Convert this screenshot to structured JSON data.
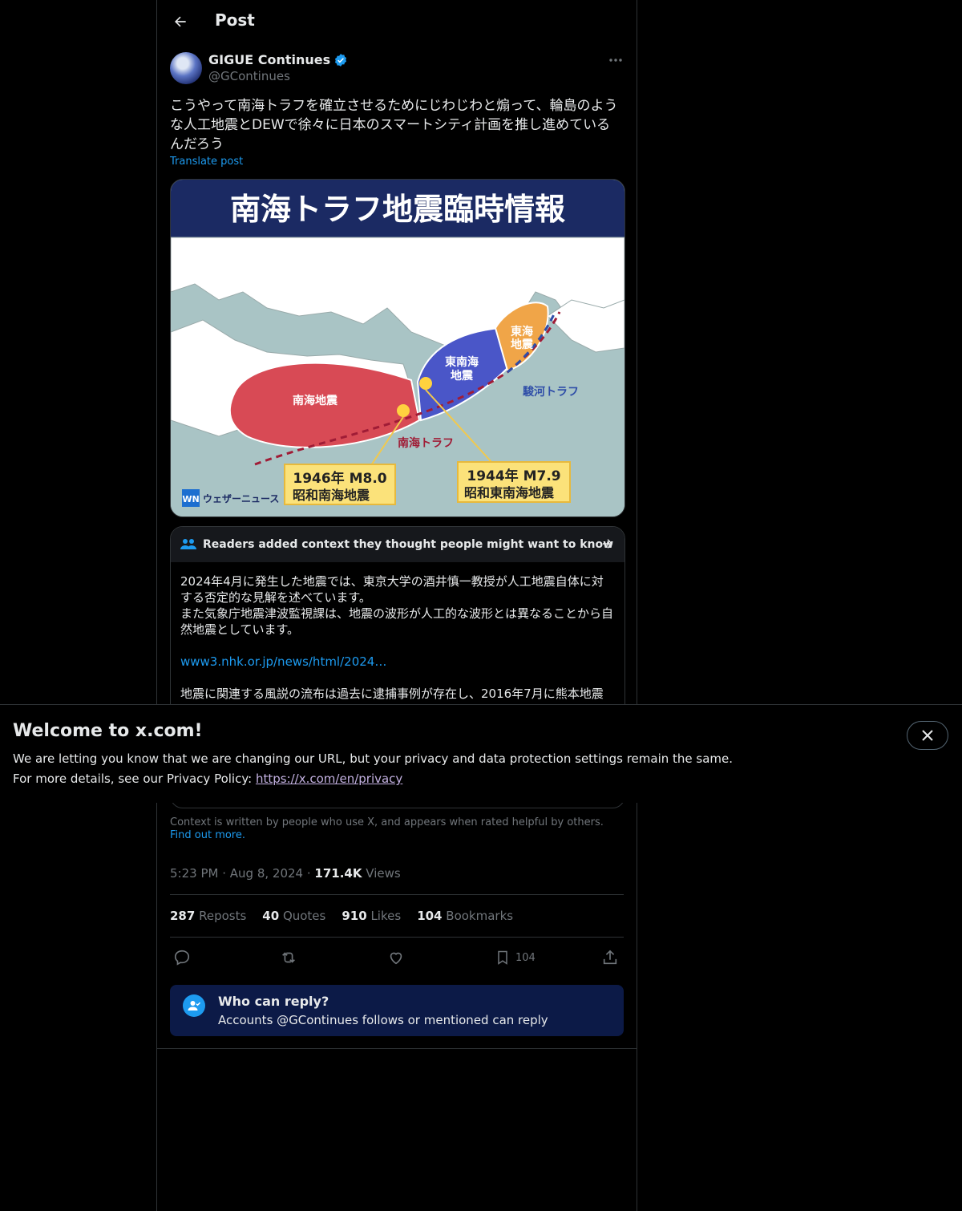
{
  "header": {
    "title": "Post"
  },
  "author": {
    "name": "GIGUE Continues",
    "handle": "@GContinues"
  },
  "post": {
    "text": "こうやって南海トラフを確立させるためにじわじわと煽って、輪島のような人工地震とDEWで徐々に日本のスマートシティ計画を推し進めているんだろう",
    "translate_label": "Translate post",
    "time": "5:23 PM",
    "date": "Aug 8, 2024",
    "views_count": "171.4K",
    "views_label": "Views"
  },
  "image": {
    "title": "南海トラフ地震臨時情報",
    "label_nankai": "南海地震",
    "label_tonankai_1": "東南海",
    "label_tonankai_2": "地震",
    "label_tokai_1": "東海",
    "label_tokai_2": "地震",
    "label_suruga": "駿河トラフ",
    "label_trough": "南海トラフ",
    "box1_line1": "1946年 M8.0",
    "box1_line2": "昭和南海地震",
    "box2_line1": "1944年 M7.9",
    "box2_line2": "昭和東南海地震",
    "logo_mark": "WN",
    "logo_text": "ウェザーニュース"
  },
  "note": {
    "header": "Readers added context they thought people might want to know",
    "para1": "2024年4月に発生した地震では、東京大学の酒井慎一教授が人工地震自体に対する否定的な見解を述べています。",
    "para2": "また気象庁地震津波監視課は、地震の波形が人工的な波形とは異なることから自然地震としています。",
    "link": "www3.nhk.or.jp/news/html/2024…",
    "para3": "地震に関連する風説の流布は過去に逮捕事例が存在し、2016年7月に熊本地震の",
    "footer": "Context is written by people who use X, and appears when rated helpful by others.",
    "footer_link": "Find out more."
  },
  "stats": {
    "reposts_count": "287",
    "reposts_label": "Reposts",
    "quotes_count": "40",
    "quotes_label": "Quotes",
    "likes_count": "910",
    "likes_label": "Likes",
    "bookmarks_count": "104",
    "bookmarks_label": "Bookmarks"
  },
  "actions": {
    "bookmark_count": "104"
  },
  "who_can_reply": {
    "title": "Who can reply?",
    "subtitle": "Accounts @GContinues follows or mentioned can reply"
  },
  "banner": {
    "title": "Welcome to x.com!",
    "line1": "We are letting you know that we are changing our URL, but your privacy and data protection settings remain the same.",
    "line2_prefix": "For more details, see our Privacy Policy:",
    "link": "https://x.com/en/privacy"
  },
  "colors": {
    "accent": "#1d9bf0",
    "background": "#000000",
    "muted": "#71767b",
    "nankai_zone": "#d84a55",
    "tonankai_zone": "#4a56c8",
    "tokai_zone": "#f0a548"
  }
}
